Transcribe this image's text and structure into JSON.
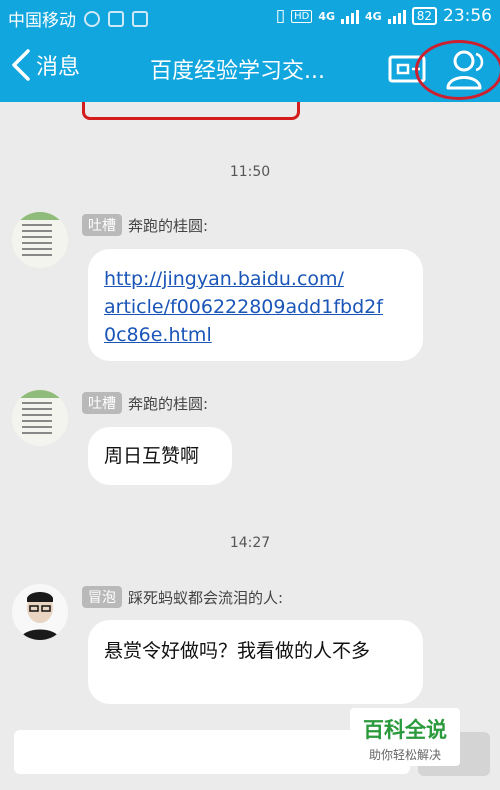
{
  "status_bar": {
    "carrier": "中国移动",
    "net_a": "4G",
    "net_b": "4G",
    "hd": "HD",
    "battery": "82",
    "time": "23:56"
  },
  "title_bar": {
    "back_label": "消息",
    "title": "百度经验学习交..."
  },
  "messages": [
    {
      "time": "11:50",
      "badge": "吐槽",
      "sender": "奔跑的桂圆:",
      "link_lines": [
        "http://jingyan.baidu.com/",
        "article/f006222809add1fbd2f",
        "0c86e.html"
      ]
    },
    {
      "badge": "吐槽",
      "sender": "奔跑的桂圆:",
      "text": "周日互赞啊"
    },
    {
      "time": "14:27",
      "badge": "冒泡",
      "sender": "踩死蚂蚁都会流泪的人:",
      "text": "悬赏令好做吗？我看做的人不多"
    }
  ],
  "watermark": {
    "title": "百科全说",
    "subtitle": "助你轻松解决"
  },
  "colors": {
    "header": "#11a6de",
    "link": "#1a55b8",
    "annotation": "#cc2030"
  }
}
